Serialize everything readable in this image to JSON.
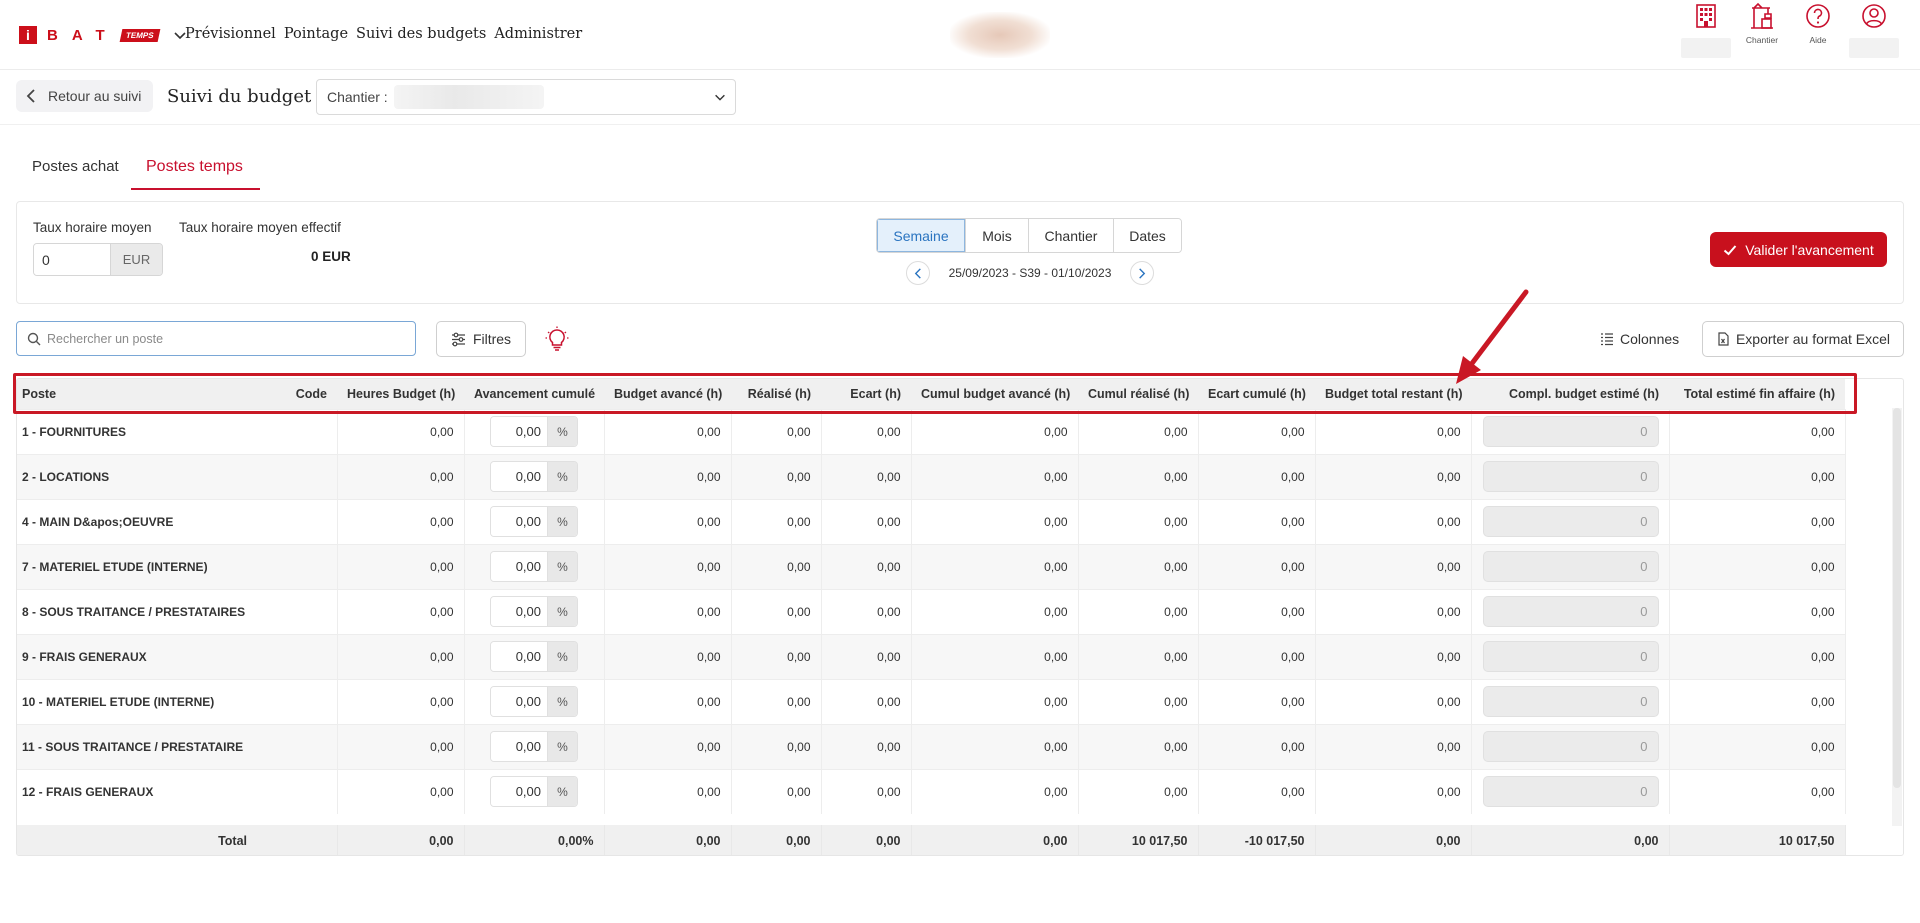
{
  "app": {
    "logo_letters": "BAT",
    "logo_badge": "TEMPS",
    "nav": [
      "Prévisionnel",
      "Pointage",
      "Suivi des budgets",
      "Administrer"
    ],
    "top_icons": [
      {
        "icon": "building-icon",
        "label": ""
      },
      {
        "icon": "crane-icon",
        "label": "Chantier"
      },
      {
        "icon": "help-icon",
        "label": "Aide"
      },
      {
        "icon": "user-icon",
        "label": ""
      }
    ],
    "accent_color": "#c8102e"
  },
  "header": {
    "back_label": "Retour au suivi",
    "title": "Suivi du budget",
    "chantier_label": "Chantier :"
  },
  "tabs": [
    {
      "label": "Postes achat",
      "active": false
    },
    {
      "label": "Postes temps",
      "active": true
    }
  ],
  "controls": {
    "taux_label": "Taux horaire moyen",
    "taux_value": "0",
    "taux_unit": "EUR",
    "taux_eff_label": "Taux horaire moyen effectif",
    "taux_eff_value": "0 EUR",
    "periods": [
      "Semaine",
      "Mois",
      "Chantier",
      "Dates"
    ],
    "active_period": "Semaine",
    "week_range": "25/09/2023 - S39 - 01/10/2023",
    "valider_label": "Valider l'avancement"
  },
  "toolbar": {
    "search_placeholder": "Rechercher un poste",
    "filtres_label": "Filtres",
    "colonnes_label": "Colonnes",
    "export_label": "Exporter au format Excel"
  },
  "table": {
    "columns": [
      "Poste",
      "Code",
      "Heures Budget (h)",
      "Avancement cumulé",
      "Budget avancé (h)",
      "Réalisé (h)",
      "Ecart (h)",
      "Cumul budget avancé (h)",
      "Cumul réalisé (h)",
      "Ecart cumulé (h)",
      "Budget total restant (h)",
      "Compl. budget estimé (h)",
      "Total estimé fin affaire (h)"
    ],
    "rows": [
      {
        "poste": "1 - FOURNITURES",
        "code": "",
        "heures_budget": "0,00",
        "avancement": "0,00",
        "pct": "%",
        "budget_avance": "0,00",
        "realise": "0,00",
        "ecart": "0,00",
        "cumul_budget_avance": "0,00",
        "cumul_realise": "0,00",
        "ecart_cumule": "0,00",
        "budget_total_restant": "0,00",
        "compl_budget": "0",
        "total_estime": "0,00"
      },
      {
        "poste": "2 - LOCATIONS",
        "code": "",
        "heures_budget": "0,00",
        "avancement": "0,00",
        "pct": "%",
        "budget_avance": "0,00",
        "realise": "0,00",
        "ecart": "0,00",
        "cumul_budget_avance": "0,00",
        "cumul_realise": "0,00",
        "ecart_cumule": "0,00",
        "budget_total_restant": "0,00",
        "compl_budget": "0",
        "total_estime": "0,00"
      },
      {
        "poste": "4 - MAIN D&apos;OEUVRE",
        "code": "",
        "heures_budget": "0,00",
        "avancement": "0,00",
        "pct": "%",
        "budget_avance": "0,00",
        "realise": "0,00",
        "ecart": "0,00",
        "cumul_budget_avance": "0,00",
        "cumul_realise": "0,00",
        "ecart_cumule": "0,00",
        "budget_total_restant": "0,00",
        "compl_budget": "0",
        "total_estime": "0,00"
      },
      {
        "poste": "7 - MATERIEL ETUDE (INTERNE)",
        "code": "",
        "heures_budget": "0,00",
        "avancement": "0,00",
        "pct": "%",
        "budget_avance": "0,00",
        "realise": "0,00",
        "ecart": "0,00",
        "cumul_budget_avance": "0,00",
        "cumul_realise": "0,00",
        "ecart_cumule": "0,00",
        "budget_total_restant": "0,00",
        "compl_budget": "0",
        "total_estime": "0,00"
      },
      {
        "poste": "8 - SOUS TRAITANCE / PRESTATAIRES",
        "code": "",
        "heures_budget": "0,00",
        "avancement": "0,00",
        "pct": "%",
        "budget_avance": "0,00",
        "realise": "0,00",
        "ecart": "0,00",
        "cumul_budget_avance": "0,00",
        "cumul_realise": "0,00",
        "ecart_cumule": "0,00",
        "budget_total_restant": "0,00",
        "compl_budget": "0",
        "total_estime": "0,00"
      },
      {
        "poste": "9 - FRAIS GENERAUX",
        "code": "",
        "heures_budget": "0,00",
        "avancement": "0,00",
        "pct": "%",
        "budget_avance": "0,00",
        "realise": "0,00",
        "ecart": "0,00",
        "cumul_budget_avance": "0,00",
        "cumul_realise": "0,00",
        "ecart_cumule": "0,00",
        "budget_total_restant": "0,00",
        "compl_budget": "0",
        "total_estime": "0,00"
      },
      {
        "poste": "10 - MATERIEL ETUDE (INTERNE)",
        "code": "",
        "heures_budget": "0,00",
        "avancement": "0,00",
        "pct": "%",
        "budget_avance": "0,00",
        "realise": "0,00",
        "ecart": "0,00",
        "cumul_budget_avance": "0,00",
        "cumul_realise": "0,00",
        "ecart_cumule": "0,00",
        "budget_total_restant": "0,00",
        "compl_budget": "0",
        "total_estime": "0,00"
      },
      {
        "poste": "11 - SOUS TRAITANCE / PRESTATAIRE",
        "code": "",
        "heures_budget": "0,00",
        "avancement": "0,00",
        "pct": "%",
        "budget_avance": "0,00",
        "realise": "0,00",
        "ecart": "0,00",
        "cumul_budget_avance": "0,00",
        "cumul_realise": "0,00",
        "ecart_cumule": "0,00",
        "budget_total_restant": "0,00",
        "compl_budget": "0",
        "total_estime": "0,00"
      },
      {
        "poste": "12 - FRAIS GENERAUX",
        "code": "",
        "heures_budget": "0,00",
        "avancement": "0,00",
        "pct": "%",
        "budget_avance": "0,00",
        "realise": "0,00",
        "ecart": "0,00",
        "cumul_budget_avance": "0,00",
        "cumul_realise": "0,00",
        "ecart_cumule": "0,00",
        "budget_total_restant": "0,00",
        "compl_budget": "0",
        "total_estime": "0,00"
      }
    ],
    "total": {
      "label": "Total",
      "heures_budget": "0,00",
      "avancement": "0,00%",
      "budget_avance": "0,00",
      "realise": "0,00",
      "ecart": "0,00",
      "cumul_budget_avance": "0,00",
      "cumul_realise": "10 017,50",
      "ecart_cumule": "-10 017,50",
      "budget_total_restant": "0,00",
      "compl_budget": "0,00",
      "total_estime": "10 017,50"
    }
  },
  "annotation": {
    "highlight_color": "#c91825"
  }
}
